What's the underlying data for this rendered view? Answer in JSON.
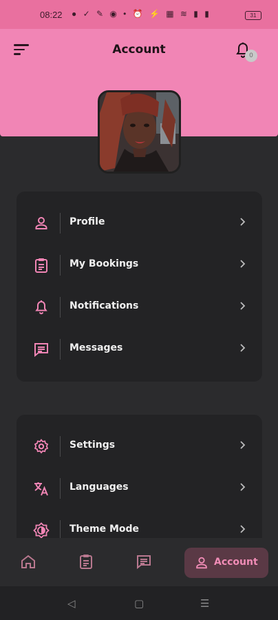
{
  "status_bar": {
    "time": "08:22",
    "icons": "● ✓ ✎ ◉ • ⏰ ⚡ ▦ ≋ ▮ ▮",
    "battery": "31"
  },
  "header": {
    "title": "Account",
    "notification_count": "0",
    "accent_color": "#f185b5"
  },
  "menu_group_1": [
    {
      "label": "Profile",
      "icon": "person-icon"
    },
    {
      "label": "My Bookings",
      "icon": "clipboard-icon"
    },
    {
      "label": "Notifications",
      "icon": "bell-icon"
    },
    {
      "label": "Messages",
      "icon": "message-icon"
    }
  ],
  "menu_group_2": [
    {
      "label": "Settings",
      "icon": "gear-icon"
    },
    {
      "label": "Languages",
      "icon": "translate-icon"
    },
    {
      "label": "Theme Mode",
      "icon": "theme-icon"
    }
  ],
  "bottom_nav": {
    "items": [
      "home-icon",
      "clipboard-icon",
      "message-icon"
    ],
    "active_label": "Account"
  }
}
